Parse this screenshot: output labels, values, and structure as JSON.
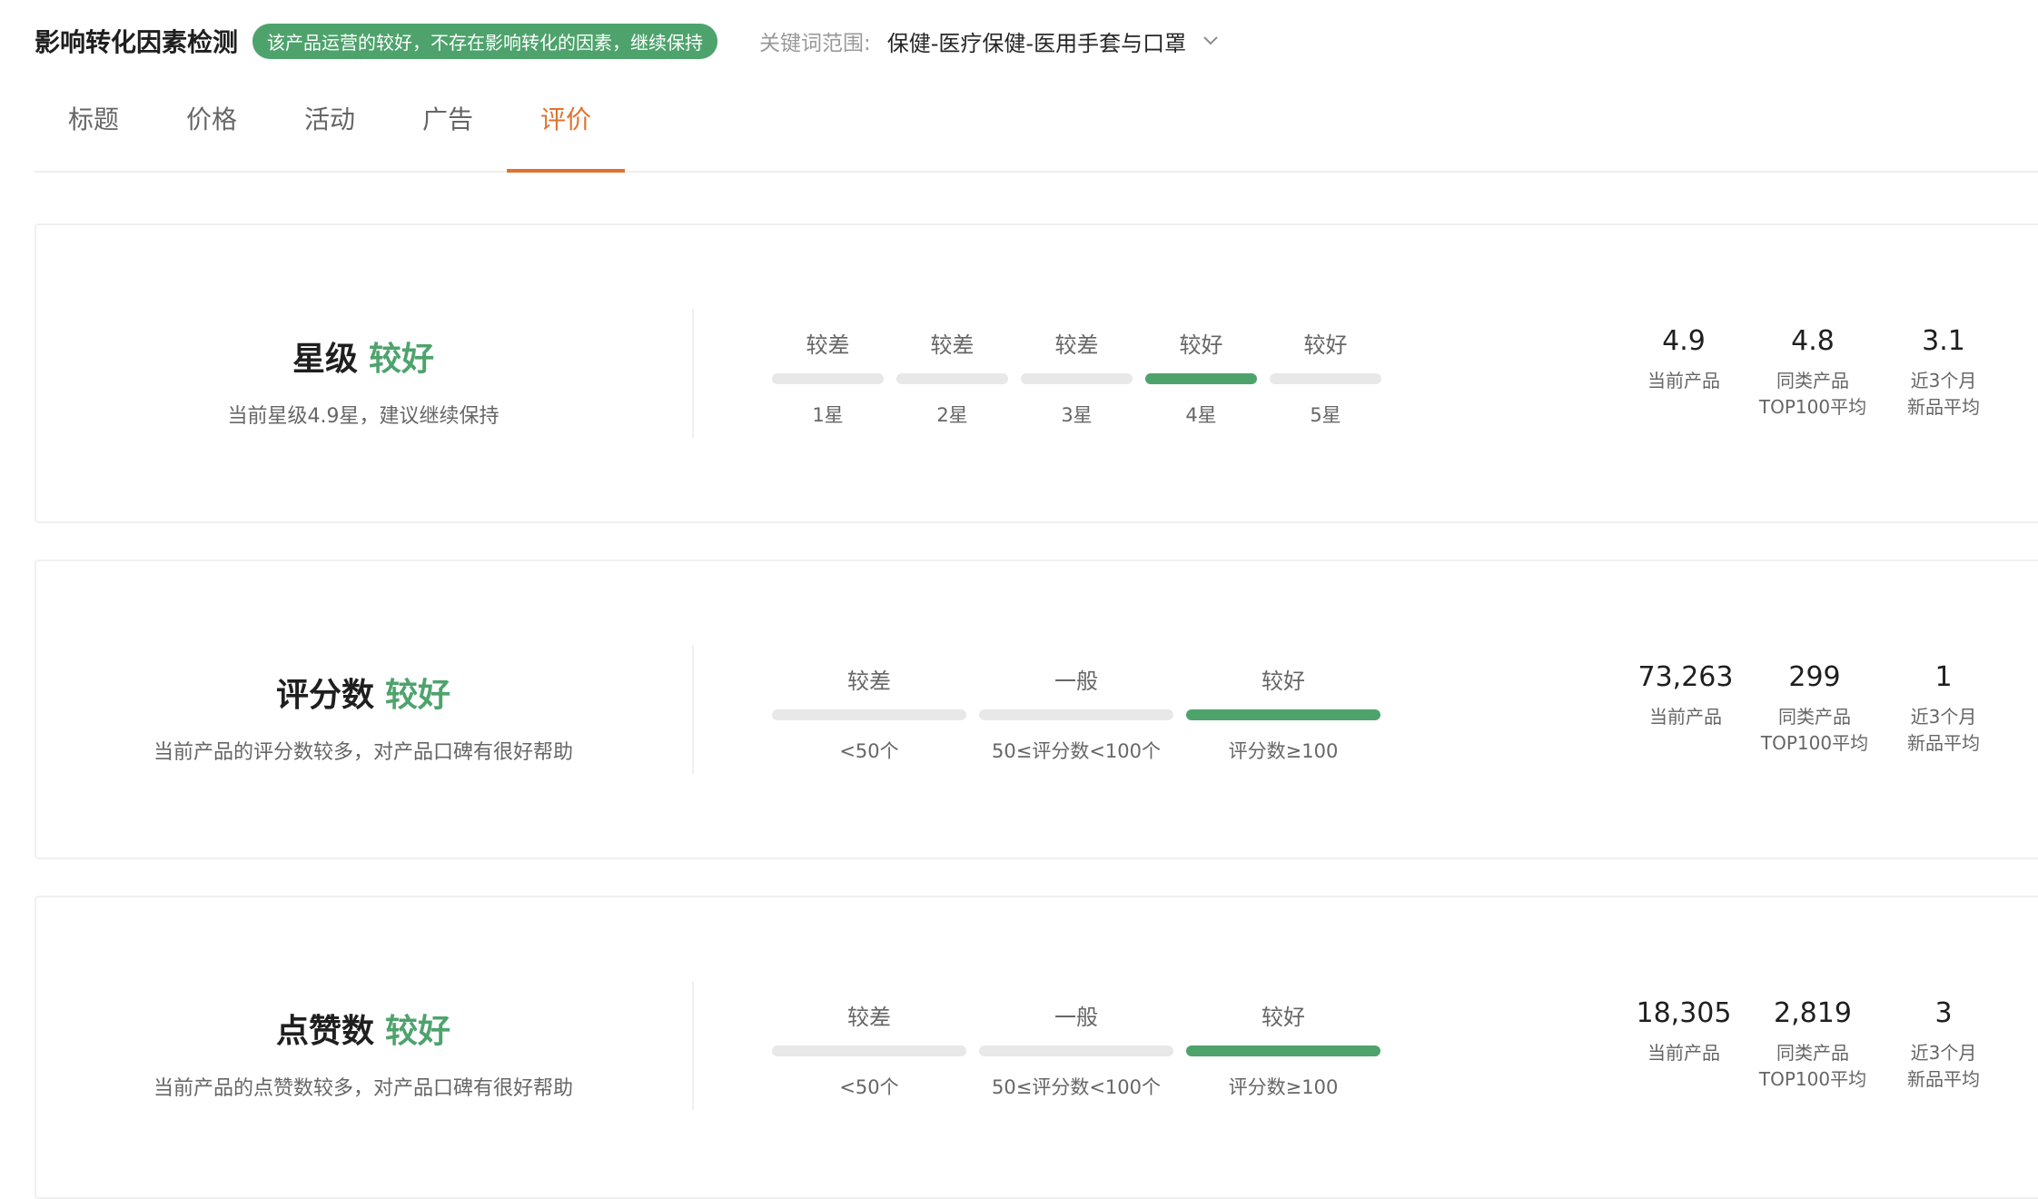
{
  "header": {
    "title": "影响转化因素检测",
    "status_tag": "该产品运营的较好，不存在影响转化的因素，继续保持",
    "keyword_label": "关键词范围:",
    "keyword_value": "保健-医疗保健-医用手套与口罩"
  },
  "tabs": [
    {
      "label": "标题",
      "active": false
    },
    {
      "label": "价格",
      "active": false
    },
    {
      "label": "活动",
      "active": false
    },
    {
      "label": "广告",
      "active": false
    },
    {
      "label": "评价",
      "active": true
    }
  ],
  "colors": {
    "accent": "#e07230",
    "good": "#4ea36c",
    "track": "#e8e8e8"
  },
  "cards": [
    {
      "title": "星级",
      "status": "较好",
      "desc": "当前星级4.9星，建议继续保持",
      "segments": [
        {
          "top": "较差",
          "bottom": "1星",
          "active": false
        },
        {
          "top": "较差",
          "bottom": "2星",
          "active": false
        },
        {
          "top": "较差",
          "bottom": "3星",
          "active": false
        },
        {
          "top": "较好",
          "bottom": "4星",
          "active": true
        },
        {
          "top": "较好",
          "bottom": "5星",
          "active": false
        }
      ],
      "stats": [
        {
          "value": "4.9",
          "label": "当前产品"
        },
        {
          "value": "4.8",
          "label": "同类产品\nTOP100平均"
        },
        {
          "value": "3.1",
          "label": "近3个月\n新品平均"
        }
      ]
    },
    {
      "title": "评分数",
      "status": "较好",
      "desc": "当前产品的评分数较多，对产品口碑有很好帮助",
      "segments": [
        {
          "top": "较差",
          "bottom": "<50个",
          "active": false
        },
        {
          "top": "一般",
          "bottom": "50≤评分数<100个",
          "active": false
        },
        {
          "top": "较好",
          "bottom": "评分数≥100",
          "active": true
        }
      ],
      "stats": [
        {
          "value": "73,263",
          "label": "当前产品"
        },
        {
          "value": "299",
          "label": "同类产品\nTOP100平均"
        },
        {
          "value": "1",
          "label": "近3个月\n新品平均"
        }
      ]
    },
    {
      "title": "点赞数",
      "status": "较好",
      "desc": "当前产品的点赞数较多，对产品口碑有很好帮助",
      "segments": [
        {
          "top": "较差",
          "bottom": "<50个",
          "active": false
        },
        {
          "top": "一般",
          "bottom": "50≤评分数<100个",
          "active": false
        },
        {
          "top": "较好",
          "bottom": "评分数≥100",
          "active": true
        }
      ],
      "stats": [
        {
          "value": "18,305",
          "label": "当前产品"
        },
        {
          "value": "2,819",
          "label": "同类产品\nTOP100平均"
        },
        {
          "value": "3",
          "label": "近3个月\n新品平均"
        }
      ]
    }
  ]
}
